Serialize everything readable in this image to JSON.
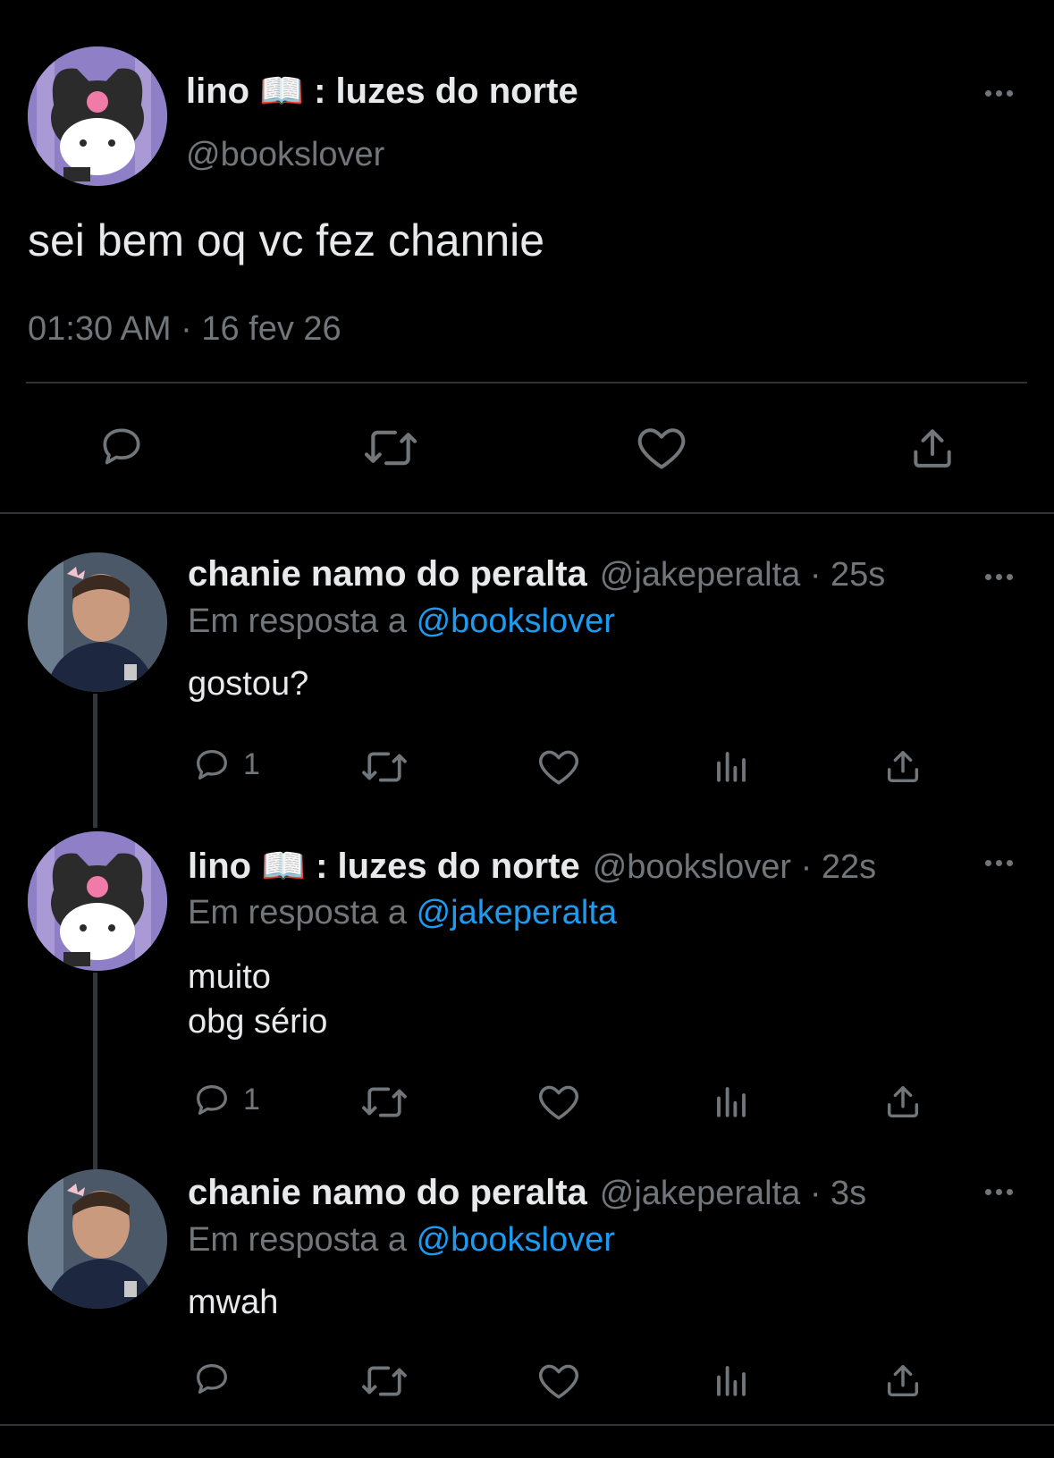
{
  "main_tweet": {
    "display_name": "lino 📖 : luzes do norte",
    "handle": "@bookslover",
    "text": "sei bem oq vc fez channie",
    "timestamp": "01:30 AM · 16 fev 26"
  },
  "replies": [
    {
      "display_name": "chanie namo do peralta",
      "handle_time": "@jakeperalta · 25s",
      "reply_prefix": "Em resposta a",
      "reply_to": "@bookslover",
      "text": "gostou?",
      "reply_count": "1"
    },
    {
      "display_name": "lino 📖 : luzes do norte",
      "handle_time": "@bookslover · 22s",
      "reply_prefix": "Em resposta a",
      "reply_to": "@jakeperalta",
      "text_line1": "muito",
      "text_line2": "obg sério",
      "reply_count": "1"
    },
    {
      "display_name": "chanie namo do peralta",
      "handle_time": "@jakeperalta · 3s",
      "reply_prefix": "Em resposta a",
      "reply_to": "@bookslover",
      "text": "mwah"
    }
  ],
  "colors": {
    "background": "#000000",
    "text": "#e7e9ea",
    "secondary": "#71767b",
    "link": "#1d9bf0",
    "divider": "#2f3336"
  },
  "icons": [
    "reply-icon",
    "retweet-icon",
    "like-icon",
    "views-icon",
    "share-icon",
    "more-icon"
  ]
}
